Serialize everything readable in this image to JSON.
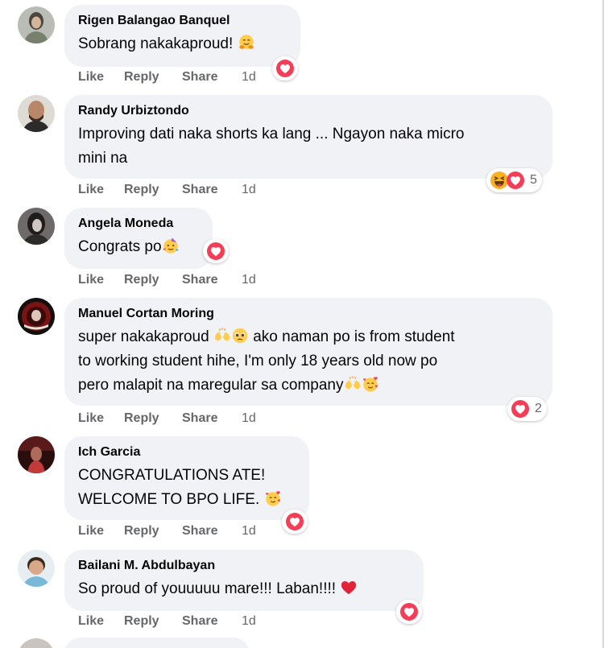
{
  "colors": {
    "bubble": "#f0f2f5",
    "meta": "#65676b",
    "love": "#f33e58",
    "haha": "#f7b125"
  },
  "actions": {
    "like": "Like",
    "reply": "Reply",
    "share": "Share"
  },
  "comments": [
    {
      "author": "Rigen Balangao Banquel",
      "lines": [
        "Sobrang nakakaproud!"
      ],
      "time": "1d",
      "reactions": [
        "love"
      ],
      "reaction_count": ""
    },
    {
      "author": "Randy Urbiztondo",
      "lines": [
        "Improving dati naka shorts ka lang ... Ngayon naka micro",
        "mini na"
      ],
      "time": "1d",
      "reactions": [
        "haha",
        "love"
      ],
      "reaction_count": "5"
    },
    {
      "author": "Angela Moneda",
      "lines": [
        "Congrats po"
      ],
      "time": "1d",
      "reactions": [
        "love"
      ],
      "reaction_count": ""
    },
    {
      "author": "Manuel Cortan Moring",
      "lines": [
        "super nakakaproud",
        "ako naman po is from student",
        "to working student hihe, I'm only 18 years old now po",
        "pero malapit na maregular sa company"
      ],
      "time": "1d",
      "reactions": [
        "love"
      ],
      "reaction_count": "2"
    },
    {
      "author": "Ich Garcia",
      "lines": [
        "CONGRATULATIONS ATE!",
        "WELCOME TO BPO LIFE."
      ],
      "time": "1d",
      "reactions": [
        "love"
      ],
      "reaction_count": ""
    },
    {
      "author": "Bailani M. Abdulbayan",
      "lines": [
        "So proud of youuuuu mare!!! Laban!!!!"
      ],
      "time": "1d",
      "reactions": [
        "love"
      ],
      "reaction_count": ""
    }
  ]
}
